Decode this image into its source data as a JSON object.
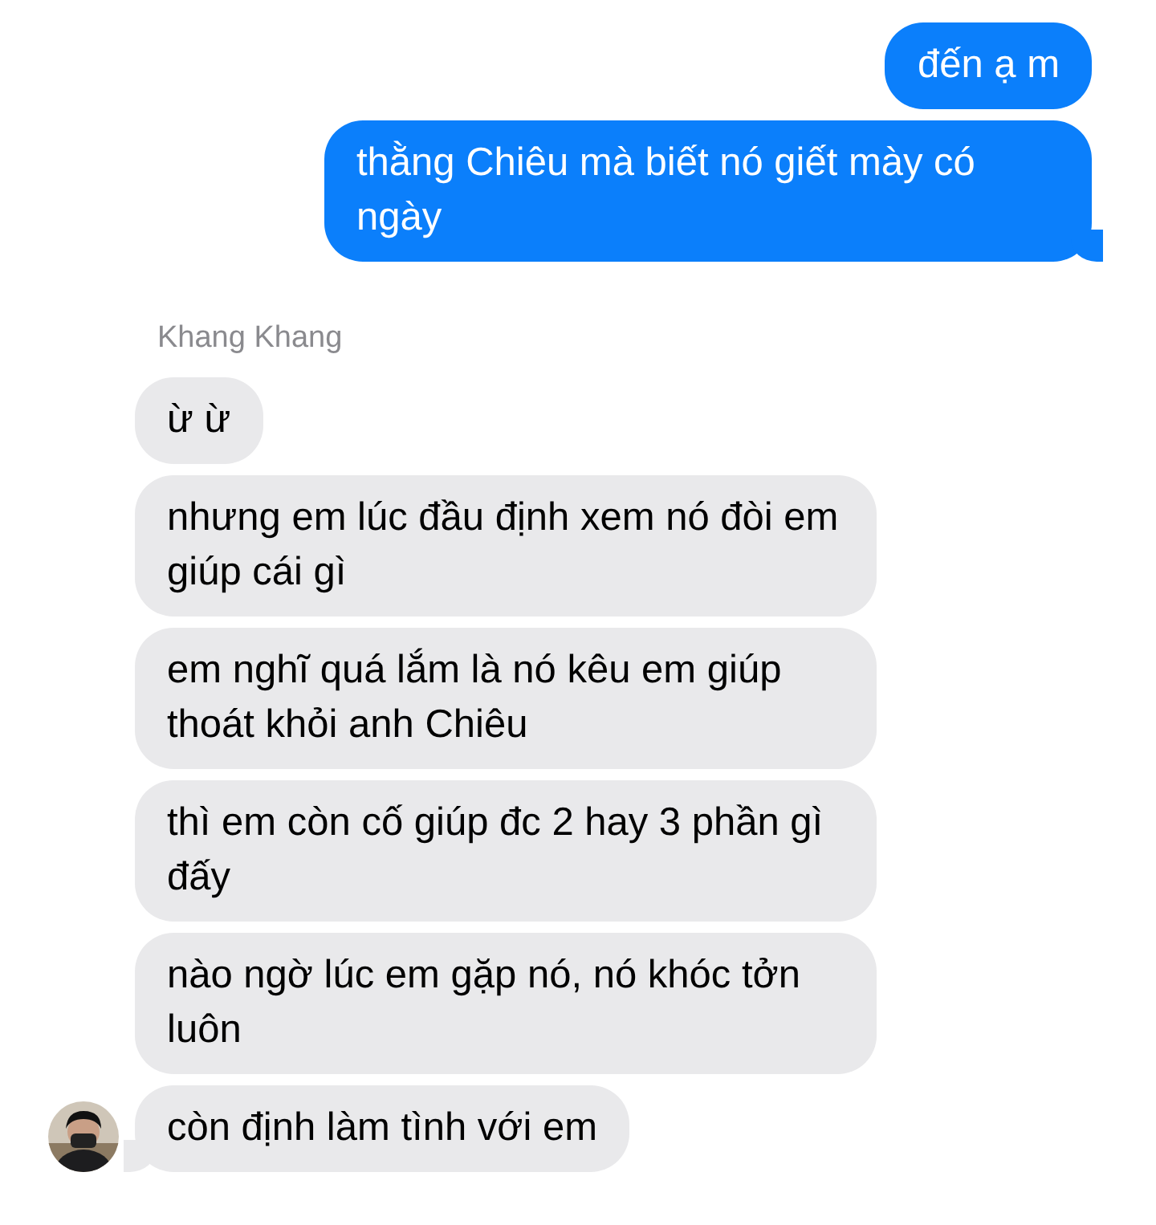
{
  "messages": [
    {
      "kind": "sent",
      "text": "đến ạ m"
    },
    {
      "kind": "sent",
      "text": "thằng Chiêu mà biết nó giết mày có ngày"
    },
    {
      "kind": "sender_name",
      "text": "Khang Khang"
    },
    {
      "kind": "received",
      "text": "ừ ừ"
    },
    {
      "kind": "received",
      "text": "nhưng em lúc đầu định xem nó đòi em giúp cái gì"
    },
    {
      "kind": "received",
      "text": "em nghĩ quá lắm là nó kêu em giúp thoát khỏi anh Chiêu"
    },
    {
      "kind": "received",
      "text": "thì em còn cố giúp đc 2 hay 3 phần gì đấy"
    },
    {
      "kind": "received",
      "text": "nào ngờ lúc em gặp nó, nó khóc tởn luôn"
    },
    {
      "kind": "received",
      "text": "còn định làm tình với em"
    }
  ]
}
